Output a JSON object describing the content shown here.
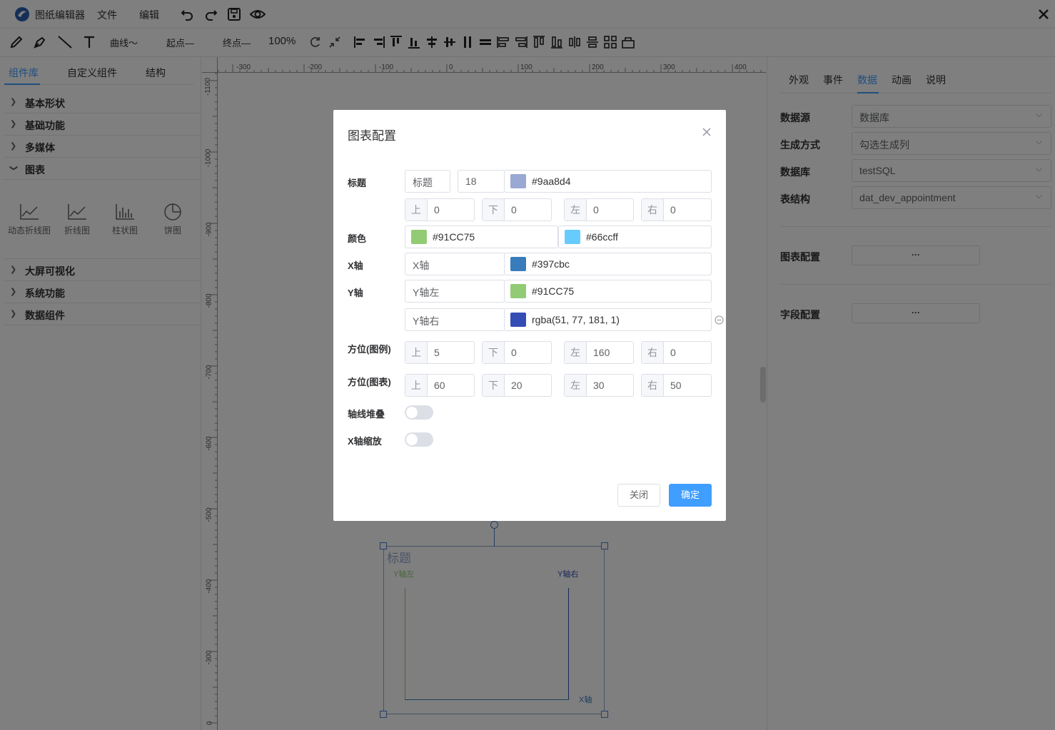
{
  "app": {
    "title": "图纸编辑器",
    "menu": [
      "文件",
      "编辑"
    ]
  },
  "toolbar": {
    "curve": "曲线～",
    "start": "起点—",
    "end": "终点—",
    "zoom": "100%"
  },
  "ruler": {
    "h": [
      "-300",
      "-200",
      "-100",
      "0",
      "100",
      "200",
      "300",
      "400"
    ],
    "v": [
      "-1100",
      "-1000",
      "-900",
      "-800",
      "-700",
      "-600",
      "-500",
      "-400",
      "-300",
      "0"
    ]
  },
  "left": {
    "tabs": [
      "组件库",
      "自定义组件",
      "结构"
    ],
    "categories": [
      "基本形状",
      "基础功能",
      "多媒体",
      "图表",
      "大屏可视化",
      "系统功能",
      "数据组件"
    ],
    "components": [
      "动态折线图",
      "折线图",
      "柱状图",
      "饼图"
    ]
  },
  "canvas": {
    "chart_title": "标题",
    "y_left": "Y轴左",
    "y_right": "Y轴右",
    "x_axis": "X轴"
  },
  "right": {
    "tabs": [
      "外观",
      "事件",
      "数据",
      "动画",
      "说明"
    ],
    "rows": [
      {
        "label": "数据源",
        "value": "数据库"
      },
      {
        "label": "生成方式",
        "value": "勾选生成列"
      },
      {
        "label": "数据库",
        "value": "testSQL"
      },
      {
        "label": "表结构",
        "value": "dat_dev_appointment"
      }
    ],
    "chart_config": "图表配置",
    "field_config": "字段配置",
    "dots": "···"
  },
  "dialog": {
    "title": "图表配置",
    "labels": {
      "title": "标题",
      "color": "颜色",
      "xaxis": "X轴",
      "yaxis": "Y轴",
      "legend_pos": "方位(图例)",
      "chart_pos": "方位(图表)",
      "stack": "轴线堆叠",
      "zoom": "X轴缩放"
    },
    "title_text": "标题",
    "title_size": "18",
    "title_color": "#9aa8d4",
    "dirs": [
      "上",
      "下",
      "左",
      "右"
    ],
    "title_margin": [
      "0",
      "0",
      "0",
      "0"
    ],
    "color1": "#91CC75",
    "color2": "#66ccff",
    "x_name": "X轴",
    "x_color": "#397cbc",
    "y_left_name": "Y轴左",
    "y_left_color": "#91CC75",
    "y_right_name": "Y轴右",
    "y_right_color": "rgba(51, 77, 181, 1)",
    "legend_pos": [
      "5",
      "0",
      "160",
      "0"
    ],
    "chart_pos": [
      "60",
      "20",
      "30",
      "50"
    ],
    "close": "关闭",
    "ok": "确定"
  },
  "colors": {
    "accent": "#409eff",
    "swatch_title": "#9aa8d4",
    "swatch_green": "#91cc75",
    "swatch_sky": "#66ccff",
    "swatch_x": "#397cbc",
    "swatch_yr": "#334db5"
  }
}
